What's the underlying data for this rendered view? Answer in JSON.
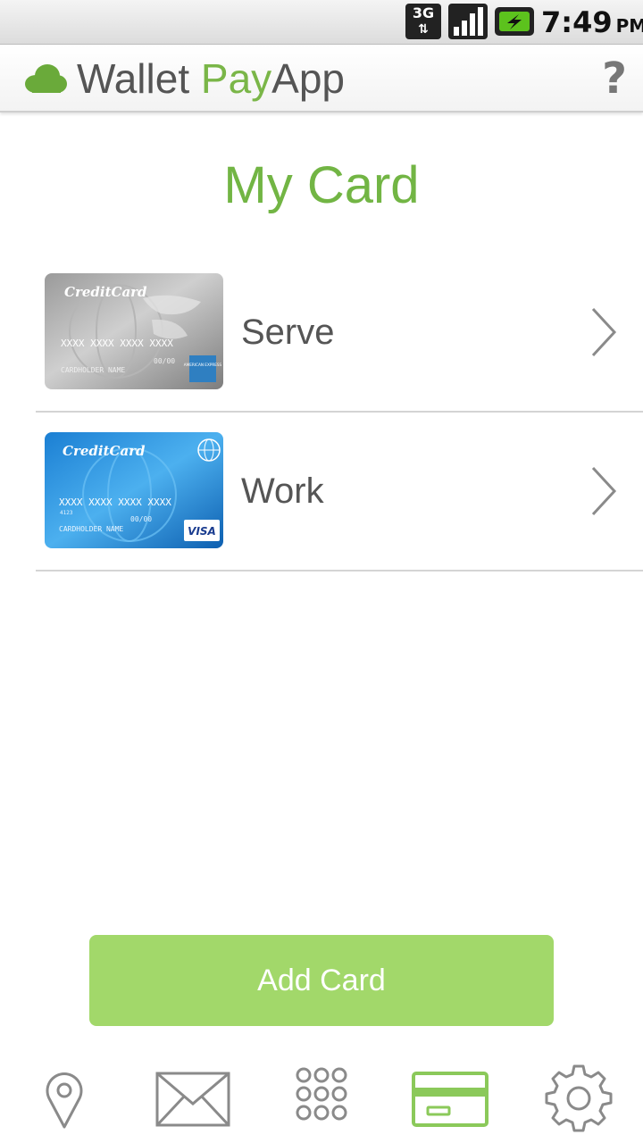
{
  "status_bar": {
    "network": "3G",
    "network_arrows": "⇅",
    "time": "7:49",
    "ampm": "PM",
    "icons": [
      "3g-data-icon",
      "signal-strength-icon",
      "battery-charging-icon"
    ]
  },
  "header": {
    "brand_part1": "Wallet ",
    "brand_part2": "Pay",
    "brand_part3": "App",
    "help_label": "?",
    "logo_icon": "cloud-icon"
  },
  "page": {
    "title": "My Card"
  },
  "cards": [
    {
      "name": "Serve",
      "thumb_brand": "CreditCard",
      "thumb_number": "XXXX XXXX XXXX XXXX",
      "thumb_expiry": "00/00",
      "thumb_holder": "CARDHOLDER NAME",
      "thumb_network": "AMERICAN EXPRESS",
      "style": "silver",
      "icon": "chevron-right-icon"
    },
    {
      "name": "Work",
      "thumb_brand": "CreditCard",
      "thumb_number": "XXXX XXXX XXXX XXXX",
      "thumb_small": "4123",
      "thumb_expiry": "00/00",
      "thumb_holder": "CARDHOLDER NAME",
      "thumb_network": "VISA",
      "style": "blue",
      "icon": "chevron-right-icon"
    }
  ],
  "actions": {
    "add_card_label": "Add Card"
  },
  "bottom_nav": [
    {
      "icon": "location-pin-icon",
      "active": false
    },
    {
      "icon": "envelope-icon",
      "active": false
    },
    {
      "icon": "keypad-grid-icon",
      "active": false
    },
    {
      "icon": "credit-card-icon",
      "active": true
    },
    {
      "icon": "gear-icon",
      "active": false
    }
  ],
  "colors": {
    "accent": "#72b544",
    "button": "#a2d86a",
    "text_gray": "#555555",
    "nav_icon": "#888888",
    "nav_active": "#8bc95a"
  }
}
